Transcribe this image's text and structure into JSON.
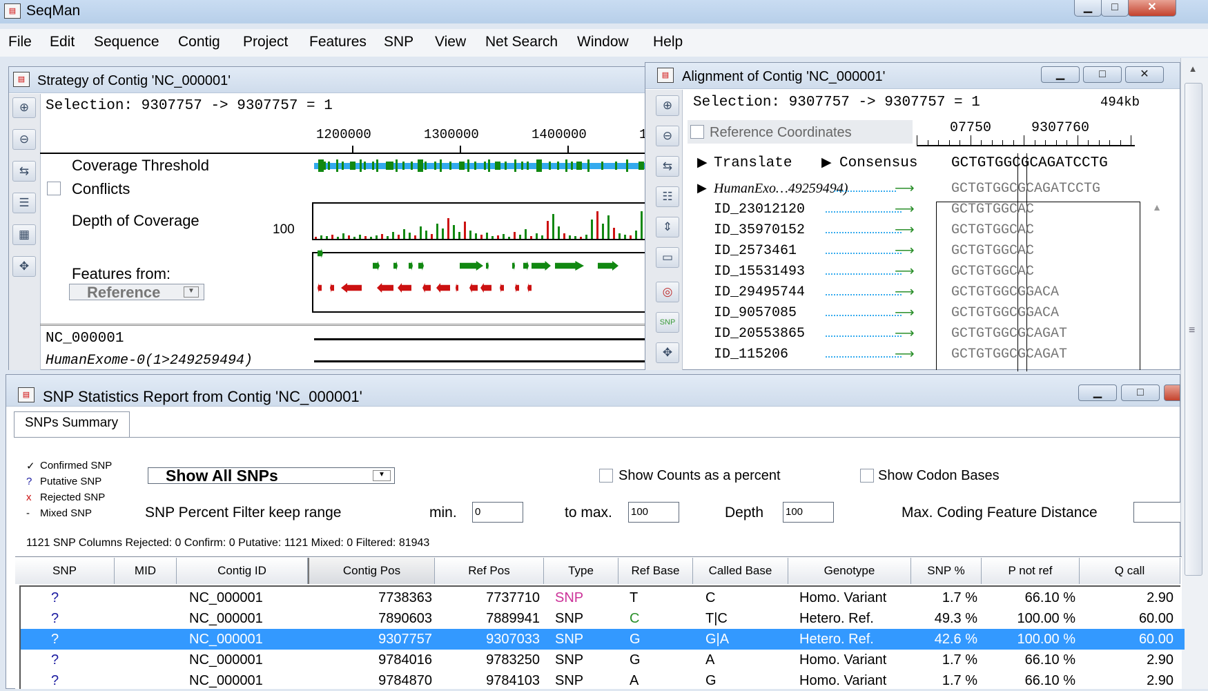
{
  "app": {
    "title": "SeqMan",
    "icon": "dna-app-icon"
  },
  "menubar": [
    "File",
    "Edit",
    "Sequence",
    "Contig",
    "Project",
    "Features",
    "SNP",
    "View",
    "Net Search",
    "Window",
    "Help"
  ],
  "strategy": {
    "title": "Strategy of Contig 'NC_000001'",
    "selection": "Selection: 9307757 -> 9307757 = 1",
    "ruler": [
      "1200000",
      "1300000",
      "1400000",
      "1"
    ],
    "labels": {
      "coverage_threshold": "Coverage Threshold",
      "conflicts": "Conflicts",
      "depth": "Depth of Coverage",
      "depth_value": "100",
      "features_from": "Features from:",
      "reference": "Reference"
    },
    "seq_names": [
      "NC_000001",
      "HumanExome-0(1>249259494)"
    ]
  },
  "alignment": {
    "title": "Alignment of Contig 'NC_000001'",
    "selection": "Selection: 9307757 -> 9307757 = 1",
    "size": "494kb",
    "ref_coords": "Reference Coordinates",
    "ruler": [
      "07750",
      "9307760"
    ],
    "translate": "Translate",
    "consensus": "Consensus",
    "consensus_seq": "GCTGTGGCGCAGATCCTG",
    "reads": [
      {
        "name": "HumanExo…49259494)",
        "seq": "GCTGTGGCGCAGATCCTG"
      },
      {
        "name": "ID_23012120",
        "seq": "GCTGTGGCAC"
      },
      {
        "name": "ID_35970152",
        "seq": "GCTGTGGCAC"
      },
      {
        "name": "ID_2573461",
        "seq": "GCTGTGGCAC"
      },
      {
        "name": "ID_15531493",
        "seq": "GCTGTGGCAC"
      },
      {
        "name": "ID_29495744",
        "seq": "GCTGTGGCGGACA"
      },
      {
        "name": "ID_9057085",
        "seq": "GCTGTGGCGGACA"
      },
      {
        "name": "ID_20553865",
        "seq": "GCTGTGGCGCAGAT"
      },
      {
        "name": "ID_115206",
        "seq": "GCTGTGGCGCAGAT"
      }
    ]
  },
  "snp": {
    "title": "SNP Statistics Report from Contig 'NC_000001'",
    "tab": "SNPs Summary",
    "legend": [
      {
        "mark": "✓",
        "label": "Confirmed SNP"
      },
      {
        "mark": "?",
        "label": "Putative SNP"
      },
      {
        "mark": "x",
        "label": "Rejected SNP"
      },
      {
        "mark": "-",
        "label": "Mixed SNP"
      }
    ],
    "filter_select": "Show All SNPs",
    "show_counts": "Show Counts as a percent",
    "show_codon": "Show Codon Bases",
    "percent_filter": "SNP Percent Filter  keep range",
    "min_label": "min.",
    "min_value": "0",
    "max_label": "to max.",
    "max_value": "100",
    "depth_label": "Depth",
    "depth_value": "100",
    "max_coding": "Max. Coding Feature Distance",
    "summary": "1121 SNP Columns Rejected: 0 Confirm: 0 Putative: 1121 Mixed: 0 Filtered: 81943",
    "columns": [
      "SNP",
      "MID",
      "Contig ID",
      "Contig Pos",
      "Ref Pos",
      "Type",
      "Ref Base",
      "Called Base",
      "Genotype",
      "SNP %",
      "P not ref",
      "Q call"
    ],
    "rows": [
      {
        "snp": "?",
        "mid": "",
        "contig": "NC_000001",
        "cpos": "7738363",
        "rpos": "7737710",
        "type": "SNP",
        "ref": "T",
        "called": "C",
        "genotype": "Homo. Variant",
        "pct": "1.7 %",
        "pnot": "66.10 %",
        "q": "2.90"
      },
      {
        "snp": "?",
        "mid": "",
        "contig": "NC_000001",
        "cpos": "7890603",
        "rpos": "7889941",
        "type": "SNP",
        "ref": "C",
        "called": "T|C",
        "genotype": "Hetero. Ref.",
        "pct": "49.3 %",
        "pnot": "100.00 %",
        "q": "60.00"
      },
      {
        "snp": "?",
        "mid": "",
        "contig": "NC_000001",
        "cpos": "9307757",
        "rpos": "9307033",
        "type": "SNP",
        "ref": "G",
        "called": "G|A",
        "genotype": "Hetero. Ref.",
        "pct": "42.6 %",
        "pnot": "100.00 %",
        "q": "60.00"
      },
      {
        "snp": "?",
        "mid": "",
        "contig": "NC_000001",
        "cpos": "9784016",
        "rpos": "9783250",
        "type": "SNP",
        "ref": "G",
        "called": "A",
        "genotype": "Homo. Variant",
        "pct": "1.7 %",
        "pnot": "66.10 %",
        "q": "2.90"
      },
      {
        "snp": "?",
        "mid": "",
        "contig": "NC_000001",
        "cpos": "9784870",
        "rpos": "9784103",
        "type": "SNP",
        "ref": "A",
        "called": "G",
        "genotype": "Homo. Variant",
        "pct": "1.7 %",
        "pnot": "66.10 %",
        "q": "2.90"
      }
    ],
    "selected_row": 2
  },
  "colors": {
    "accent": "#3399ff",
    "type_snp_magenta": "#cc3399",
    "ref_c_green": "#2a8f2a",
    "feature_green": "#118811",
    "feature_red": "#cc1111",
    "coverage_blue": "#33aaee"
  }
}
